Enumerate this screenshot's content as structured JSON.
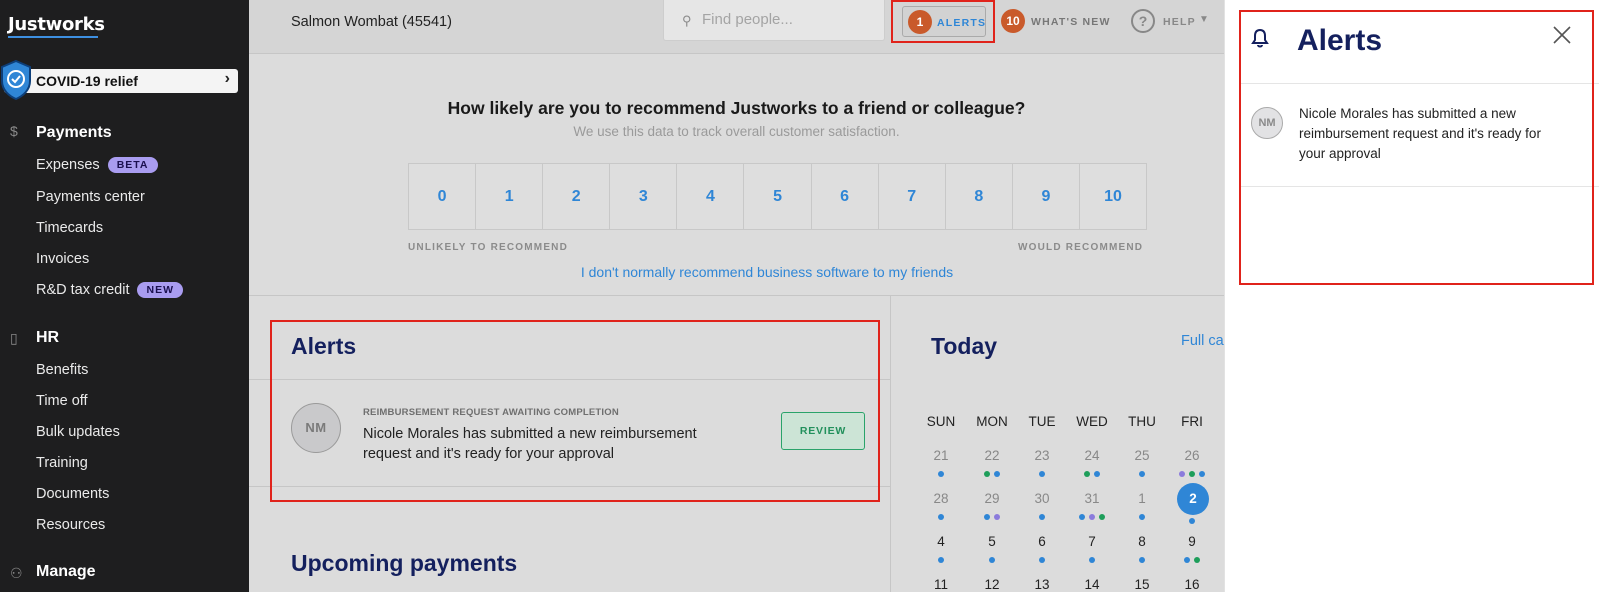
{
  "sidebar": {
    "logo": "Justworks",
    "covid_label": "COVID-19 relief",
    "payments": {
      "title": "Payments",
      "items": [
        {
          "label": "Expenses",
          "badge": "BETA"
        },
        {
          "label": "Payments center"
        },
        {
          "label": "Timecards"
        },
        {
          "label": "Invoices"
        },
        {
          "label": "R&D tax credit",
          "badge": "NEW"
        }
      ]
    },
    "hr": {
      "title": "HR",
      "items": [
        {
          "label": "Benefits"
        },
        {
          "label": "Time off"
        },
        {
          "label": "Bulk updates"
        },
        {
          "label": "Training"
        },
        {
          "label": "Documents"
        },
        {
          "label": "Resources"
        }
      ]
    },
    "manage": {
      "title": "Manage"
    }
  },
  "topbar": {
    "company": "Salmon Wombat (45541)",
    "search_placeholder": "Find people...",
    "alerts_count": "1",
    "alerts_label": "ALERTS",
    "whatsnew_count": "10",
    "whatsnew_label": "WHAT'S NEW",
    "help_label": "HELP"
  },
  "survey": {
    "question": "How likely are you to recommend Justworks to a friend or colleague?",
    "subtitle": "We use this data to track overall customer satisfaction.",
    "scale": [
      "0",
      "1",
      "2",
      "3",
      "4",
      "5",
      "6",
      "7",
      "8",
      "9",
      "10"
    ],
    "low_label": "UNLIKELY TO RECOMMEND",
    "high_label": "WOULD RECOMMEND",
    "opt_out_link": "I don't normally recommend business software to my friends"
  },
  "alerts_card": {
    "title": "Alerts",
    "avatar_initials": "NM",
    "category": "REIMBURSEMENT REQUEST AWAITING COMPLETION",
    "message": "Nicole Morales has submitted a new reimbursement request and it's ready for your approval",
    "review_label": "REVIEW"
  },
  "payments_card": {
    "title": "Upcoming payments"
  },
  "today_card": {
    "title": "Today",
    "full_calendar_link": "Full calendar",
    "weekdays": [
      "SUN",
      "MON",
      "TUE",
      "WED",
      "THU",
      "FRI"
    ],
    "weeks": [
      [
        "21",
        "22",
        "23",
        "24",
        "25",
        "26"
      ],
      [
        "28",
        "29",
        "30",
        "31",
        "1",
        "2"
      ],
      [
        "4",
        "5",
        "6",
        "7",
        "8",
        "9"
      ],
      [
        "11",
        "12",
        "13",
        "14",
        "15",
        "16"
      ]
    ],
    "today": "2"
  },
  "alerts_panel": {
    "title": "Alerts",
    "avatar_initials": "NM",
    "message": "Nicole Morales has submitted a new reimbursement request and it's ready for your approval"
  },
  "colors": {
    "accent_blue": "#2f86d6",
    "navy": "#14205e",
    "badge_orange": "#c95a2b",
    "highlight_red": "#e0231b",
    "review_green": "#2aa36a",
    "dot_blue": "#2f86d6",
    "dot_green": "#1e9e5a",
    "dot_purple": "#8b7bdc"
  }
}
